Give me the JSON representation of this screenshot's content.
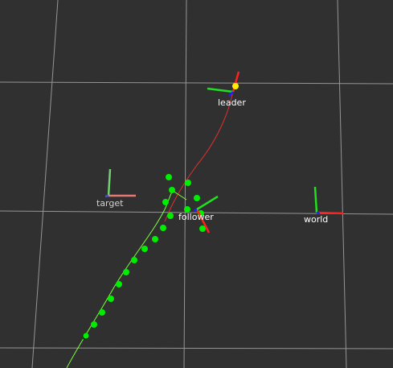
{
  "scene": {
    "background": "#303030",
    "grid_color": "#a0a0a0",
    "axis_colors": {
      "x": "#ff2020",
      "y": "#20e020",
      "z": "#2020ff"
    }
  },
  "frames": {
    "leader": {
      "label": "leader"
    },
    "target": {
      "label": "target"
    },
    "follower": {
      "label": "follower"
    },
    "world": {
      "label": "world"
    }
  },
  "paths": {
    "leader_path_color": "#e03030",
    "follower_path_color": "#7cff3c",
    "waypoint_color": "#00ee00",
    "leader_marker_color": "#ffee00"
  }
}
